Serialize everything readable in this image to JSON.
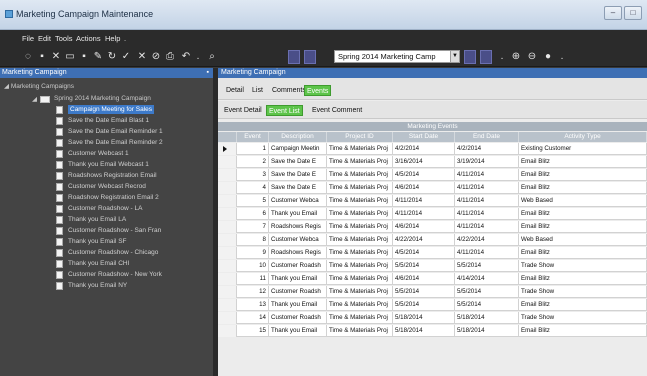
{
  "window": {
    "title": "Marketing Campaign Maintenance"
  },
  "menu": [
    "File",
    "Edit",
    "Tools",
    "Actions",
    "Help",
    "."
  ],
  "toolbar": {
    "combo_value": "Spring 2014 Marketing Camp"
  },
  "left_panel": {
    "header": "Marketing Campaign",
    "root": "Marketing Campaigns",
    "campaign": "Spring 2014 Marketing Campaign",
    "items": [
      "Campaign Meeting for Sales",
      "Save the Date Email Blast 1",
      "Save the Date Email Reminder 1",
      "Save the Date Email Reminder 2",
      "Customer Webcast 1",
      "Thank you Email Webcast 1",
      "Roadshows Registration Email",
      "Customer Webcast Recrod",
      "Roadshow Registration Email 2",
      "Customer Roadshow - LA",
      "Thank you Email LA",
      "Customer Roadshow - San Fran",
      "Thank you Email SF",
      "Customer Roadshow - Chicago",
      "Thank you Email CHI",
      "Customer Roadshow - New York",
      "Thank you Email NY"
    ],
    "selected_index": 0
  },
  "right_panel": {
    "header": "Marketing Campaign",
    "tabs": [
      "Detail",
      "List",
      "Comments",
      "Events"
    ],
    "active_tab": 3,
    "subtabs": [
      "Event Detail",
      "Event List",
      "Event Comment"
    ],
    "active_subtab": 1,
    "grid_title": "Marketing Events",
    "columns": [
      "Event",
      "Description",
      "Project ID",
      "Start Date",
      "End Date",
      "Activity Type"
    ],
    "rows": [
      [
        "1",
        "Campaign Meetin",
        "Time & Materials Proj",
        "4/2/2014",
        "4/2/2014",
        "Existing Customer"
      ],
      [
        "2",
        "Save the Date E",
        "Time & Materials Proj",
        "3/16/2014",
        "3/19/2014",
        "Email Blitz"
      ],
      [
        "3",
        "Save the Date E",
        "Time & Materials Proj",
        "4/5/2014",
        "4/11/2014",
        "Email Blitz"
      ],
      [
        "4",
        "Save the Date E",
        "Time & Materials Proj",
        "4/6/2014",
        "4/11/2014",
        "Email Blitz"
      ],
      [
        "5",
        "Customer Webca",
        "Time & Materials Proj",
        "4/11/2014",
        "4/11/2014",
        "Web Based"
      ],
      [
        "6",
        "Thank you Email",
        "Time & Materials Proj",
        "4/11/2014",
        "4/11/2014",
        "Email Blitz"
      ],
      [
        "7",
        "Roadshows Regis",
        "Time & Materials Proj",
        "4/6/2014",
        "4/11/2014",
        "Email Blitz"
      ],
      [
        "8",
        "Customer Webca",
        "Time & Materials Proj",
        "4/22/2014",
        "4/22/2014",
        "Web Based"
      ],
      [
        "9",
        "Roadshows Regis",
        "Time & Materials Proj",
        "4/5/2014",
        "4/11/2014",
        "Email Blitz"
      ],
      [
        "10",
        "Customer Roadsh",
        "Time & Materials Proj",
        "5/5/2014",
        "5/5/2014",
        "Trade Show"
      ],
      [
        "11",
        "Thank you Email",
        "Time & Materials Proj",
        "4/6/2014",
        "4/14/2014",
        "Email Blitz"
      ],
      [
        "12",
        "Customer Roadsh",
        "Time & Materials Proj",
        "5/5/2014",
        "5/5/2014",
        "Trade Show"
      ],
      [
        "13",
        "Thank you Email",
        "Time & Materials Proj",
        "5/5/2014",
        "5/5/2014",
        "Email Blitz"
      ],
      [
        "14",
        "Customer Roadsh",
        "Time & Materials Proj",
        "5/18/2014",
        "5/18/2014",
        "Trade Show"
      ],
      [
        "15",
        "Thank you Email",
        "Time & Materials Proj",
        "5/18/2014",
        "5/18/2014",
        "Email Blitz"
      ]
    ],
    "selected_row": 0
  }
}
